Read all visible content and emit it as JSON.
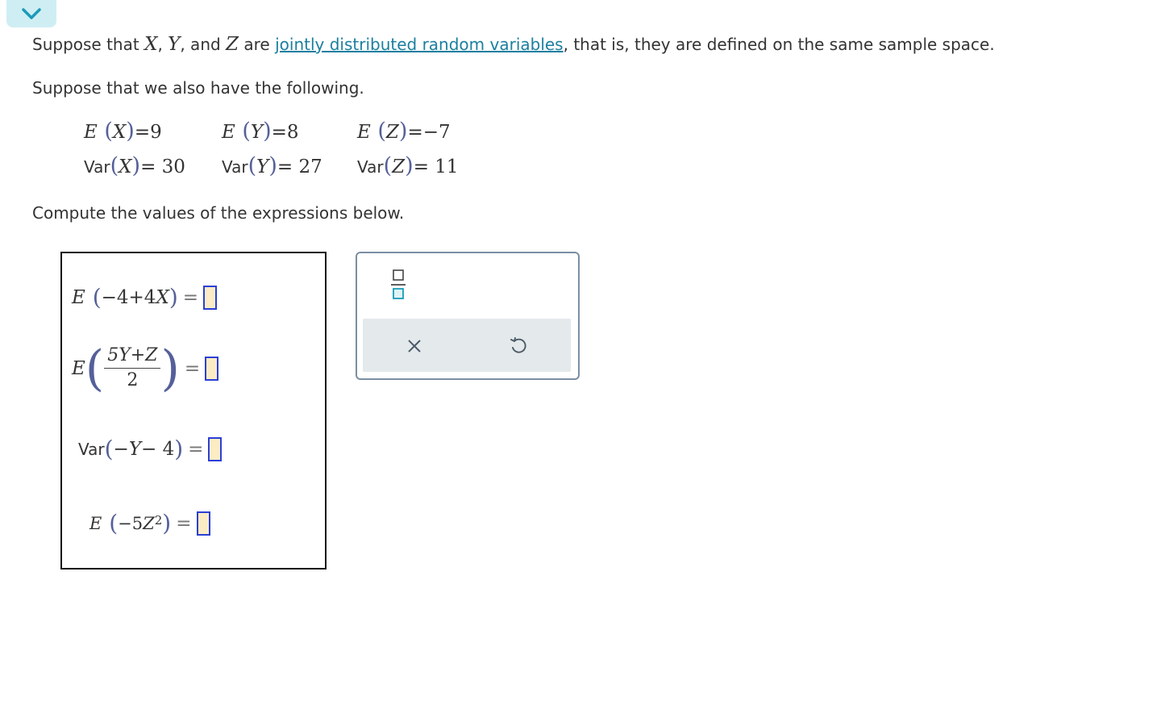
{
  "toggle": {
    "icon": "chevron-down-icon"
  },
  "intro": {
    "p1_a": "Suppose that ",
    "var_x": "X",
    "sep1": ", ",
    "var_y": "Y",
    "sep2": ", and ",
    "var_z": "Z",
    "p1_b": " are ",
    "link": "jointly distributed random variables",
    "p1_c": ", that is, they are defined on the same sample space.",
    "p2": "Suppose that we also have the following.",
    "p3": "Compute the values of the expressions below."
  },
  "given": {
    "ex": {
      "fn": "E",
      "var": "X",
      "val": "=9"
    },
    "ey": {
      "fn": "E",
      "var": "Y",
      "val": "=8"
    },
    "ez": {
      "fn": "E",
      "var": "Z",
      "val": "=−7"
    },
    "vx": {
      "fn": "Var",
      "var": "X",
      "val": "= 30"
    },
    "vy": {
      "fn": "Var",
      "var": "Y",
      "val": "= 27"
    },
    "vz": {
      "fn": "Var",
      "var": "Z",
      "val": "= 11"
    }
  },
  "expressions": {
    "e1": {
      "fn": "E",
      "inner": "−4+4",
      "var": "X",
      "eq": "="
    },
    "e2": {
      "fn": "E",
      "numerator": "5Y+Z",
      "denominator": "2",
      "eq": "="
    },
    "e3": {
      "fn": "Var",
      "inner_a": "− ",
      "var": "Y",
      "inner_b": "− 4",
      "eq": "="
    },
    "e4": {
      "fn": "E",
      "inner_a": "−5",
      "var": "Z",
      "exp": "2",
      "eq": "="
    }
  },
  "answers": {
    "e1": "",
    "e2": "",
    "e3": "",
    "e4": ""
  },
  "tools": {
    "fraction_icon": "fraction-icon",
    "clear_icon": "close-icon",
    "undo_icon": "undo-icon"
  },
  "colors": {
    "link": "#1b7fa0",
    "toggle_bg": "#cfeef4",
    "answer_fill": "#fcecc4",
    "answer_border": "#2b3fd6",
    "toolbar_bg": "#e4e9ec"
  }
}
